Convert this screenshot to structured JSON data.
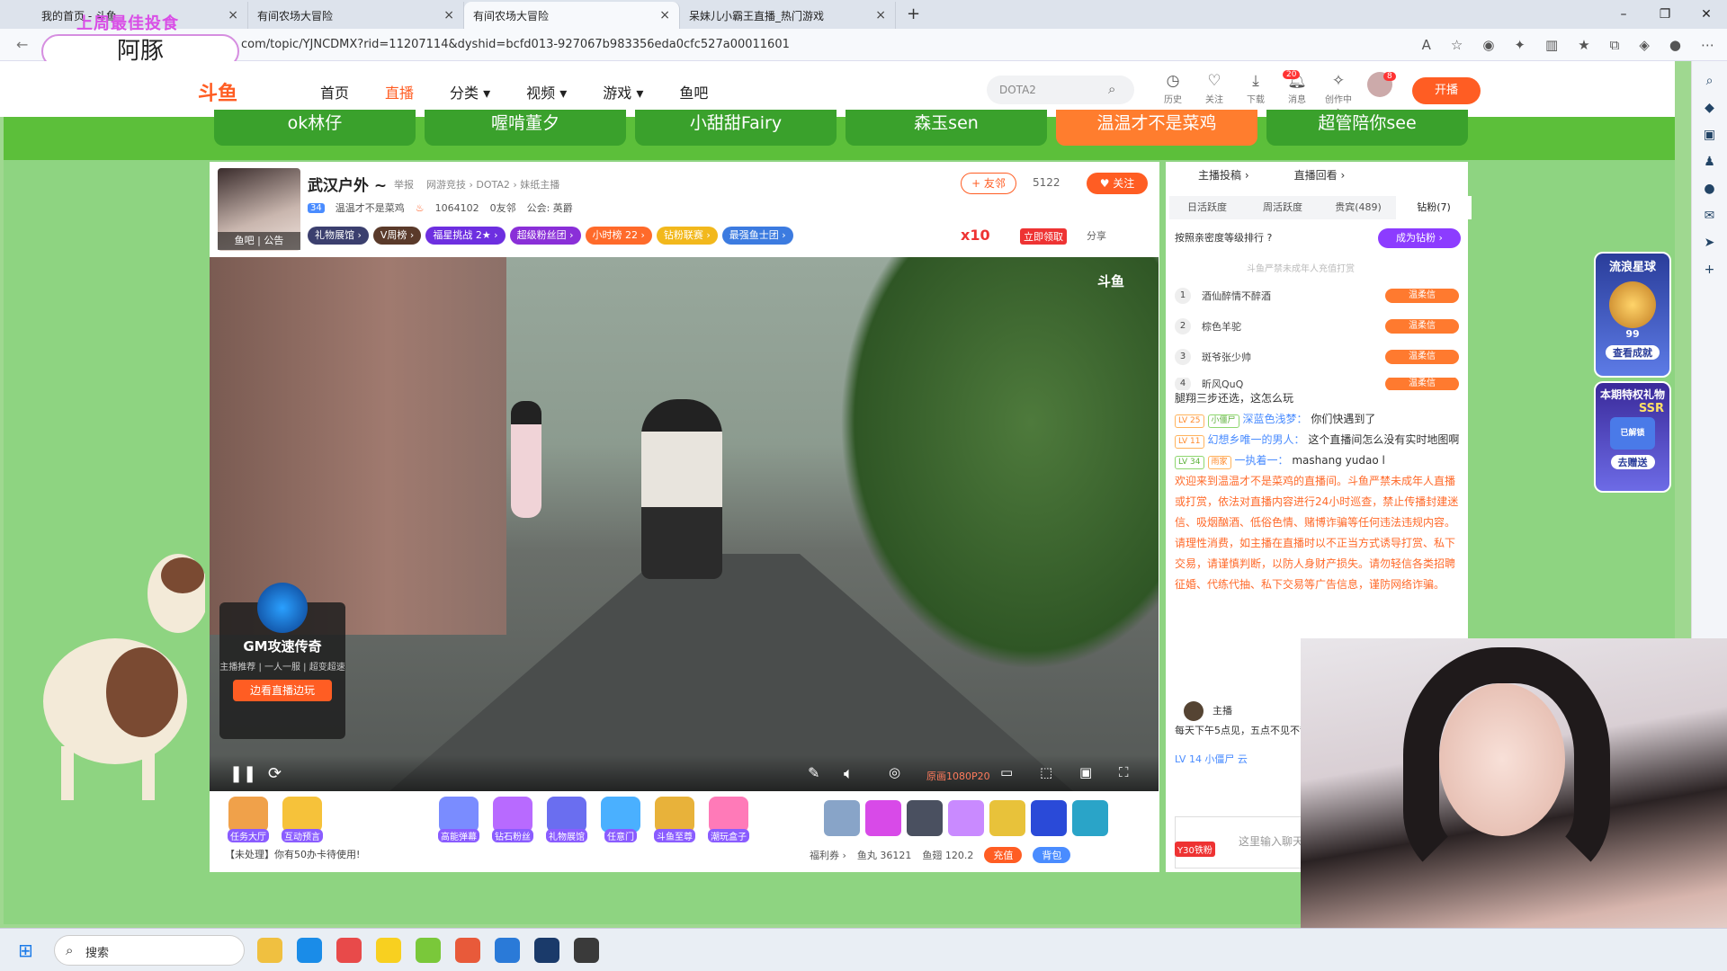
{
  "browser": {
    "tabs": [
      {
        "title": "我的首页 - 斗鱼"
      },
      {
        "title": "有间农场大冒险"
      },
      {
        "title": "有间农场大冒险"
      },
      {
        "title": "呆妹儿小霸王直播_热门游戏"
      }
    ],
    "url": "com/topic/YJNCDMX?rid=11207114&dyshid=bcfd013-927067b983356eda0cfc527a00011601",
    "new_tab": "+"
  },
  "overlay": {
    "line1": "上周最佳投食",
    "line2": "阿豚"
  },
  "header": {
    "logo": "斗鱼",
    "nav": [
      {
        "label": "首页"
      },
      {
        "label": "直播"
      },
      {
        "label": "分类 ▾"
      },
      {
        "label": "视频 ▾"
      },
      {
        "label": "游戏 ▾"
      },
      {
        "label": "鱼吧"
      }
    ],
    "search_placeholder": "DOTA2",
    "icons": [
      {
        "label": "历史"
      },
      {
        "label": "关注"
      },
      {
        "label": "下载"
      },
      {
        "label": "消息"
      },
      {
        "label": "创作中心"
      }
    ],
    "msg_count": "20",
    "user_count": "8",
    "kaibo": "开播"
  },
  "recommend": [
    {
      "name": "ok林仔"
    },
    {
      "name": "喔啃董夕"
    },
    {
      "name": "小甜甜Fairy"
    },
    {
      "name": "森玉sen"
    },
    {
      "name": "温温才不是菜鸡"
    },
    {
      "name": "超管陪你see"
    }
  ],
  "streamer": {
    "name": "武汉户外 ~",
    "report": "举报",
    "crumb": "网游竞技 › DOTA2 › 妹纸主播",
    "level": "34",
    "host": "温温才不是菜鸡",
    "heat": "1064102",
    "friends": "0友邻",
    "guild": "公会: 英爵",
    "avatar_label": "鱼吧 | 公告",
    "pills": [
      {
        "label": "礼物展馆 ›",
        "color": "#3b3f6e"
      },
      {
        "label": "V周榜 ›",
        "color": "#5a3a2a"
      },
      {
        "label": "福星挑战 2★ ›",
        "color": "#6d2fe0"
      },
      {
        "label": "超级粉丝团 ›",
        "color": "#8a2fd8"
      },
      {
        "label": "小时榜 22 ›",
        "color": "#ff6a2a"
      },
      {
        "label": "钻粉联赛 ›",
        "color": "#f2b81c"
      },
      {
        "label": "最强鱼士团 ›",
        "color": "#3c7be0"
      }
    ],
    "friend_btn": "+ 友邻",
    "follow_count": "5122",
    "follow_btn": "♥ 关注",
    "x10": "x10",
    "lingqu": "立即领取",
    "share": "分享"
  },
  "video": {
    "logo": "斗鱼",
    "quality": "原画1080P20",
    "gm": {
      "title": "GM攻速传奇",
      "tags": "主播推荐 | 一人一服 | 超变超速",
      "btn": "边看直播边玩"
    }
  },
  "giftbar": {
    "left": [
      {
        "label": "任务大厅",
        "color": "#f0a14a"
      },
      {
        "label": "互动预言",
        "color": "#f6c23a"
      }
    ],
    "gifts": [
      {
        "label": "高能弹幕",
        "color": "#7a8cff"
      },
      {
        "label": "钻石粉丝",
        "color": "#b86aff"
      },
      {
        "label": "礼物展馆",
        "color": "#6a6ef0"
      },
      {
        "label": "任意门",
        "color": "#4ab0ff"
      },
      {
        "label": "斗鱼至尊",
        "color": "#e8b23a"
      },
      {
        "label": "潮玩盒子",
        "color": "#ff7ab8"
      }
    ],
    "items": [
      {
        "color": "#88a4c8"
      },
      {
        "color": "#d84ae8"
      },
      {
        "color": "#4a5060"
      },
      {
        "color": "#c98aff"
      },
      {
        "color": "#e8c23a"
      },
      {
        "color": "#2a4ad8"
      },
      {
        "color": "#2aa4c8"
      }
    ],
    "notice": "【未处理】你有50办卡待使用!",
    "welfare": "福利券 ›",
    "yuwan": "鱼丸 36121",
    "yuchi": "鱼翅 120.2",
    "recharge": "充值",
    "backpack": "背包"
  },
  "rpanel": {
    "top": [
      {
        "label": "主播投稿 ›"
      },
      {
        "label": "直播回看 ›"
      }
    ],
    "tabs": [
      {
        "label": "日活跃度"
      },
      {
        "label": "周活跃度"
      },
      {
        "label": "贵宾(489)"
      },
      {
        "label": "钻粉(7)"
      }
    ],
    "rank_hdr": "按照亲密度等级排行 ?",
    "beguard": "成为钻粉 ›",
    "rank_note": "斗鱼严禁未成年人充值打赏",
    "ranks": [
      {
        "n": "1",
        "name": "酒仙醉情不醉酒",
        "tag": "温柔信"
      },
      {
        "n": "2",
        "name": "棕色羊驼",
        "tag": "温柔信"
      },
      {
        "n": "3",
        "name": "斑爷张少帅",
        "tag": "温柔信"
      },
      {
        "n": "4",
        "name": "昕风QuQ",
        "tag": "温柔信"
      }
    ],
    "chat": [
      {
        "type": "text",
        "text": "腿翔三步还选，这怎么玩"
      },
      {
        "type": "msg",
        "lv": "LV 25",
        "badge": "小僵尸",
        "user": "深蓝色浅梦：",
        "text": "你们快遇到了"
      },
      {
        "type": "msg",
        "lv": "LV 11",
        "badge": "",
        "user": "幻想乡唯一的男人：",
        "text": "这个直播间怎么没有实时地图啊"
      },
      {
        "type": "msg",
        "lv": "LV 34",
        "badge": "雨家",
        "user": "一执着一：",
        "text": "mashang yudao l"
      },
      {
        "type": "tip",
        "text": "欢迎来到温温才不是菜鸡的直播间。斗鱼严禁未成年人直播或打赏，依法对直播内容进行24小时巡查，禁止传播封建迷信、吸烟酗酒、低俗色情、赌博诈骗等任何违法违规内容。请理性消费，如主播在直播时以不正当方式诱导打赏、私下交易，请谨慎判断，以防人身财产损失。请勿轻信各类招聘征婚、代练代抽、私下交易等广告信息，谨防网络诈骗。"
      }
    ],
    "host_label": "主播",
    "host_notice": "每天下午5点见，五点不见不散",
    "chat_tail": "LV 14  小僵尸  云",
    "input_placeholder": "这里输入聊天内容",
    "vip_label": "Y30铁粉"
  },
  "floats": {
    "a_title": "流浪星球",
    "a_num": "99",
    "a_btn": "查看成就",
    "b_title": "本期特权礼物",
    "b_tag": "SSR",
    "b_sub": "已解锁",
    "b_btn": "去赠送"
  },
  "taskbar": {
    "search": "搜索",
    "apps": [
      {
        "color": "#f0c040"
      },
      {
        "color": "#1a8ce8"
      },
      {
        "color": "#e84a4a"
      },
      {
        "color": "#f8d020"
      },
      {
        "color": "#7ac83a"
      },
      {
        "color": "#e85a3a"
      },
      {
        "color": "#2a7ad8"
      },
      {
        "color": "#1a3a6a"
      },
      {
        "color": "#3a3a3a"
      }
    ]
  }
}
